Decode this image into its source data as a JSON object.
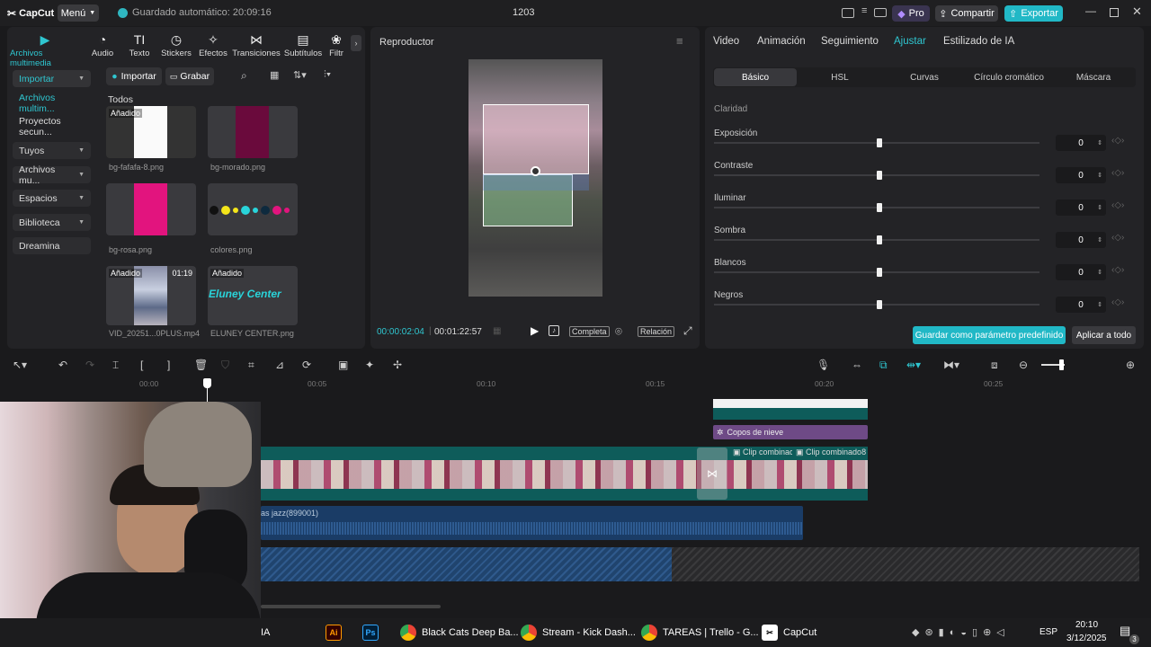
{
  "titlebar": {
    "logo": "CapCut",
    "menu": "Menú",
    "autosave": "Guardado automático: 20:09:16",
    "project": "1203",
    "pro": "Pro",
    "share": "Compartir",
    "export": "Exportar"
  },
  "media": {
    "tools": [
      {
        "label": "Archivos multimedia",
        "icon": "media-icon"
      },
      {
        "label": "Audio",
        "icon": "audio-icon"
      },
      {
        "label": "Texto",
        "icon": "text-icon"
      },
      {
        "label": "Stickers",
        "icon": "sticker-icon"
      },
      {
        "label": "Efectos",
        "icon": "effects-icon"
      },
      {
        "label": "Transiciones",
        "icon": "transitions-icon"
      },
      {
        "label": "Subtítulos",
        "icon": "subtitles-icon"
      },
      {
        "label": "Filtr",
        "icon": "filters-icon"
      }
    ],
    "sidebar": [
      {
        "label": "Importar"
      },
      {
        "label": "Archivos multim..."
      },
      {
        "label": "Proyectos secun..."
      },
      {
        "label": "Tuyos"
      },
      {
        "label": "Archivos mu..."
      },
      {
        "label": "Espacios"
      },
      {
        "label": "Biblioteca"
      },
      {
        "label": "Dreamina"
      }
    ],
    "import_btn": "Importar",
    "record_btn": "Grabar",
    "all_label": "Todos",
    "items": [
      {
        "name": "bg-fafafa-8.png",
        "badge": "Añadido",
        "duration": ""
      },
      {
        "name": "bg-morado.png",
        "badge": "",
        "duration": ""
      },
      {
        "name": "bg-rosa.png",
        "badge": "",
        "duration": ""
      },
      {
        "name": "colores.png",
        "badge": "",
        "duration": ""
      },
      {
        "name": "VID_20251...0PLUS.mp4",
        "badge": "Añadido",
        "duration": "01:19"
      },
      {
        "name": "ELUNEY CENTER.png",
        "badge": "Añadido",
        "duration": "",
        "logo_text": "Eluney Center"
      }
    ]
  },
  "player": {
    "title": "Reproductor",
    "current_time": "00:00:02:04",
    "total_time": "00:01:22:57",
    "full_btn": "Completa",
    "ratio_btn": "Relación"
  },
  "adjust": {
    "tabs": [
      "Video",
      "Animación",
      "Seguimiento",
      "Ajustar",
      "Estilizado de IA"
    ],
    "active_tab": "Ajustar",
    "subtabs": [
      "Básico",
      "HSL",
      "Curvas",
      "Círculo cromático",
      "Máscara"
    ],
    "section": "Claridad",
    "sliders": [
      {
        "label": "Exposición",
        "value": "0",
        "level": 0
      },
      {
        "label": "Contraste",
        "value": "0",
        "level": 0
      },
      {
        "label": "Iluminar",
        "value": "0",
        "level": 0
      },
      {
        "label": "Sombra",
        "value": "0",
        "level": 0
      },
      {
        "label": "Blancos",
        "value": "0",
        "level": 0
      },
      {
        "label": "Negros",
        "value": "0",
        "level": 0
      }
    ],
    "save_preset": "Guardar como parámetro predefinido",
    "apply_all": "Aplicar a todo"
  },
  "timeline": {
    "ruler": [
      "00:00",
      "00:05",
      "00:10",
      "00:15",
      "00:20",
      "00:25"
    ],
    "effect_clip": "Copos de nieve",
    "combined_1": "Clip combinac",
    "combined_2": "Clip combinado8",
    "audio_clip": "as jazz(899001)"
  },
  "taskbar": {
    "tasks": [
      "Black Cats Deep Ba...",
      "Stream - Kick Dash...",
      "TAREAS | Trello - G...",
      "CapCut"
    ],
    "partial": "IA",
    "lang": "ESP",
    "time": "20:10",
    "date": "3/12/2025",
    "notif": "3"
  },
  "colors": {
    "accent": "#2fc6d0",
    "track_teal": "#0e5c5a",
    "audio_blue": "#1a3c66",
    "effect_purple": "#6e4a86"
  }
}
